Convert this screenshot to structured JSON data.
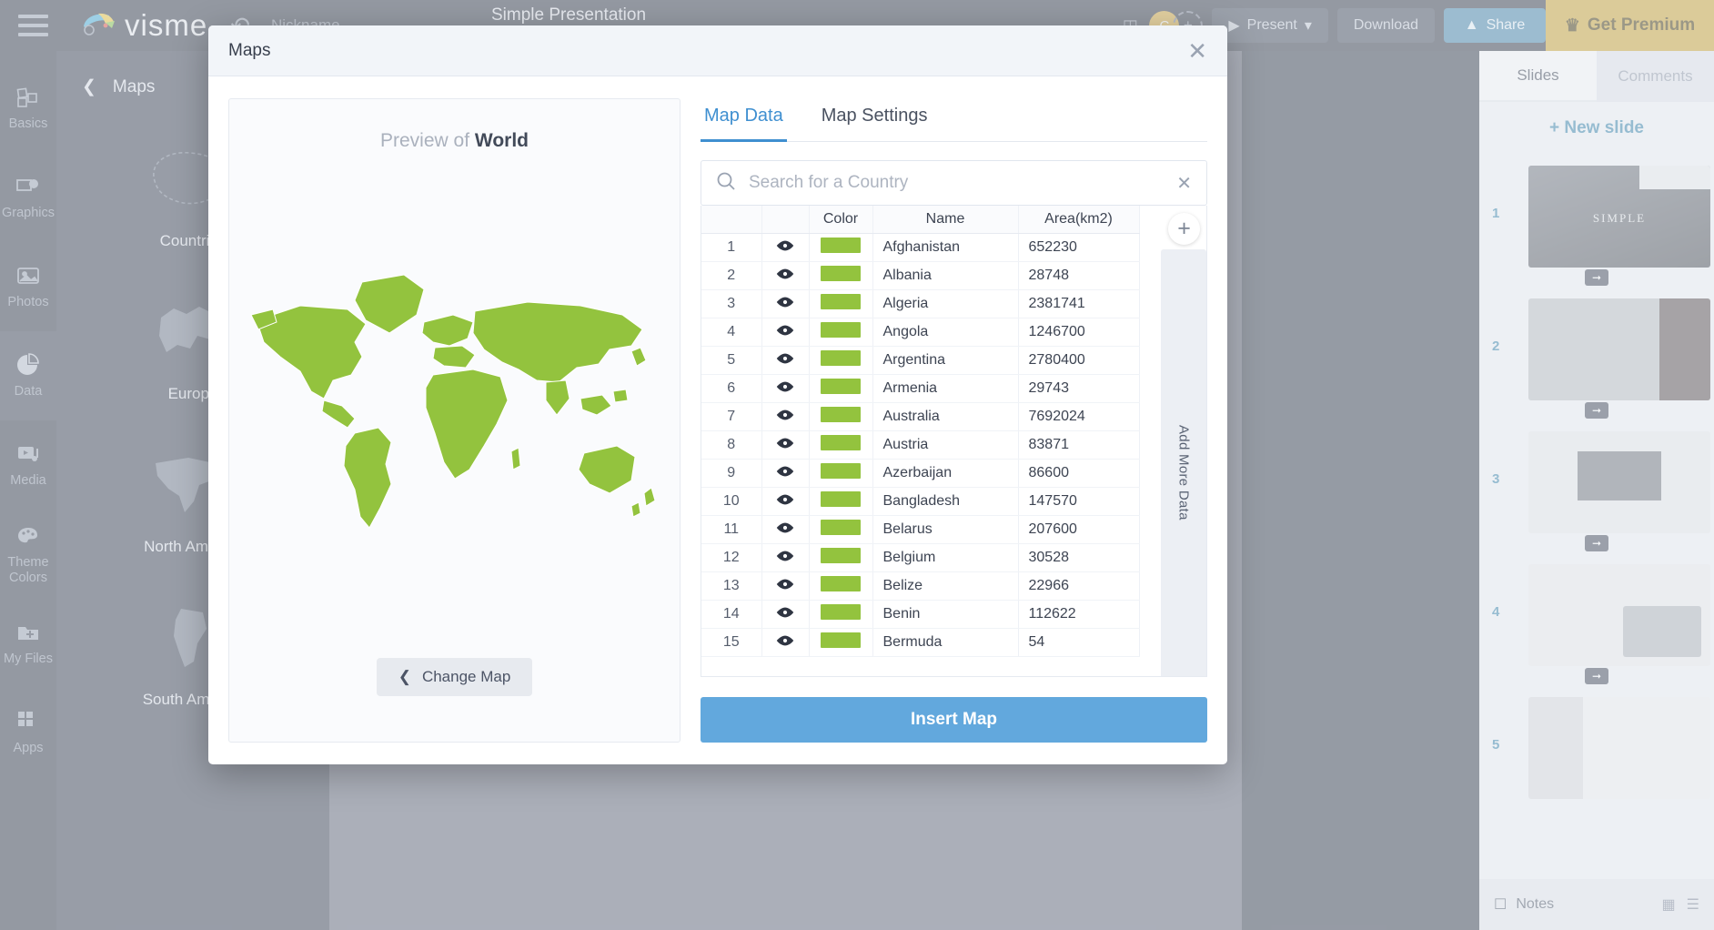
{
  "app": {
    "brand_name": "visme",
    "nickname": "Nickname",
    "doc_title": "Simple Presentation",
    "undo_icon": "undo-arrow-icon",
    "menu_icon": "hamburger-menu-icon",
    "topbar": {
      "avatar_initial": "C",
      "avatar_add": "+",
      "present_label": "Present",
      "present_icon": "play-icon",
      "present_caret": "▾",
      "download_label": "Download",
      "share_label": "Share",
      "share_icon": "share-icon",
      "premium_label": "Get Premium",
      "premium_icon": "crown-icon",
      "note_icon": "note-icon"
    },
    "rail": [
      {
        "label": "Basics",
        "icon": "blocks-icon",
        "active": false
      },
      {
        "label": "Graphics",
        "icon": "graphics-icon",
        "active": false
      },
      {
        "label": "Photos",
        "icon": "photo-icon",
        "active": false
      },
      {
        "label": "Data",
        "icon": "pie-chart-icon",
        "active": true
      },
      {
        "label": "Media",
        "icon": "media-play-icon",
        "active": false
      },
      {
        "label": "Theme Colors",
        "icon": "palette-icon",
        "active": false
      },
      {
        "label": "My Files",
        "icon": "folder-plus-icon",
        "active": false
      },
      {
        "label": "Apps",
        "icon": "apps-grid-icon",
        "active": false
      }
    ],
    "maps_panel": {
      "back_icon": "chevron-left-icon",
      "title": "Maps",
      "tiles": [
        {
          "label": "Countries"
        },
        {
          "label": "Europe"
        },
        {
          "label": "North America"
        },
        {
          "label": "South America"
        }
      ]
    },
    "slides_panel": {
      "tabs": [
        {
          "label": "Slides",
          "active": true
        },
        {
          "label": "Comments",
          "active": false
        }
      ],
      "new_slide_label": "+ New slide",
      "slides": [
        {
          "number": "1",
          "caption": "SIMPLE"
        },
        {
          "number": "2",
          "caption": ""
        },
        {
          "number": "3",
          "caption": ""
        },
        {
          "number": "4",
          "caption": ""
        },
        {
          "number": "5",
          "caption": ""
        }
      ],
      "notes_label": "Notes",
      "notes_icon": "notes-icon",
      "grid_icon": "grid-view-icon",
      "list_icon": "list-view-icon"
    }
  },
  "modal": {
    "title": "Maps",
    "close_icon": "close-icon",
    "preview": {
      "title_prefix": "Preview of ",
      "title_map": "World",
      "change_map_label": "Change Map",
      "change_map_icon": "chevron-left-icon",
      "map_fill_color": "#93c33e"
    },
    "tabs": [
      {
        "label": "Map Data",
        "active": true
      },
      {
        "label": "Map Settings",
        "active": false
      }
    ],
    "search": {
      "placeholder": "Search for a Country",
      "value": "",
      "search_icon": "search-icon",
      "clear_icon": "clear-icon"
    },
    "table": {
      "headers": [
        "",
        "",
        "Color",
        "Name",
        "Area(km2)"
      ],
      "eye_icon": "eye-visible-icon",
      "row_color": "#93c33e",
      "rows": [
        {
          "index": "1",
          "name": "Afghanistan",
          "area": "652230"
        },
        {
          "index": "2",
          "name": "Albania",
          "area": "28748"
        },
        {
          "index": "3",
          "name": "Algeria",
          "area": "2381741"
        },
        {
          "index": "4",
          "name": "Angola",
          "area": "1246700"
        },
        {
          "index": "5",
          "name": "Argentina",
          "area": "2780400"
        },
        {
          "index": "6",
          "name": "Armenia",
          "area": "29743"
        },
        {
          "index": "7",
          "name": "Australia",
          "area": "7692024"
        },
        {
          "index": "8",
          "name": "Austria",
          "area": "83871"
        },
        {
          "index": "9",
          "name": "Azerbaijan",
          "area": "86600"
        },
        {
          "index": "10",
          "name": "Bangladesh",
          "area": "147570"
        },
        {
          "index": "11",
          "name": "Belarus",
          "area": "207600"
        },
        {
          "index": "12",
          "name": "Belgium",
          "area": "30528"
        },
        {
          "index": "13",
          "name": "Belize",
          "area": "22966"
        },
        {
          "index": "14",
          "name": "Benin",
          "area": "112622"
        },
        {
          "index": "15",
          "name": "Bermuda",
          "area": "54"
        }
      ]
    },
    "add_more_data_label": "Add More Data",
    "add_more_icon": "plus-icon",
    "insert_label": "Insert Map"
  },
  "colors": {
    "accent_blue": "#3f8fd0",
    "insert_button": "#62a8dd",
    "map_green": "#93c33e",
    "premium_gold": "#c8a02e",
    "dark_chrome": "#2b3242"
  }
}
